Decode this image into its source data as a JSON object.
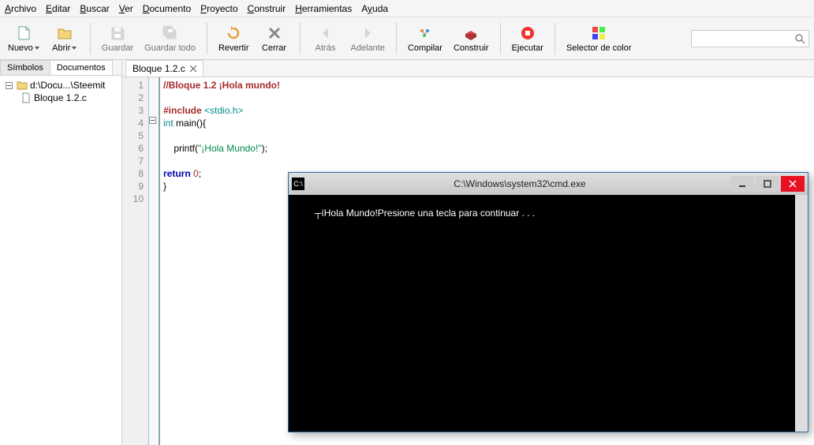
{
  "menu": [
    "Archivo",
    "Editar",
    "Buscar",
    "Ver",
    "Documento",
    "Proyecto",
    "Construir",
    "Herramientas",
    "Ayuda"
  ],
  "menu_accel": [
    0,
    0,
    0,
    0,
    0,
    0,
    0,
    0,
    1
  ],
  "toolbar": [
    {
      "id": "nuevo",
      "label": "Nuevo",
      "icon": "new",
      "dd": true
    },
    {
      "id": "abrir",
      "label": "Abrir",
      "icon": "open",
      "dd": true
    },
    {
      "sep": true
    },
    {
      "id": "guardar",
      "label": "Guardar",
      "icon": "save",
      "dis": true
    },
    {
      "id": "guardartodo",
      "label": "Guardar todo",
      "icon": "saveall",
      "dis": true
    },
    {
      "sep": true
    },
    {
      "id": "revertir",
      "label": "Revertir",
      "icon": "revert"
    },
    {
      "id": "cerrar",
      "label": "Cerrar",
      "icon": "close"
    },
    {
      "sep": true
    },
    {
      "id": "atras",
      "label": "Atrás",
      "icon": "back",
      "dis": true
    },
    {
      "id": "adelante",
      "label": "Adelante",
      "icon": "fwd",
      "dis": true
    },
    {
      "sep": true
    },
    {
      "id": "compilar",
      "label": "Compilar",
      "icon": "compile"
    },
    {
      "id": "construir",
      "label": "Construir",
      "icon": "build"
    },
    {
      "sep": true
    },
    {
      "id": "ejecutar",
      "label": "Ejecutar",
      "icon": "run"
    },
    {
      "sep": true
    },
    {
      "id": "selcolor",
      "label": "Selector de color",
      "icon": "color"
    }
  ],
  "sidebar": {
    "tabs": [
      "Símbolos",
      "Documentos"
    ],
    "active": 1,
    "folder": "d:\\Docu...\\Steemit",
    "file": "Bloque 1.2.c"
  },
  "editor_tab": "Bloque 1.2.c",
  "code_lines": [
    {
      "n": 1,
      "html": "<span class='c-brown'>//Bloque 1.2 ¡Hola mundo!</span>"
    },
    {
      "n": 2,
      "html": ""
    },
    {
      "n": 3,
      "html": "<span class='c-brown'>#include</span> <span class='c-type'>&lt;stdio.h&gt;</span>"
    },
    {
      "n": 4,
      "html": "<span class='c-type'>int</span> main(){",
      "fold": "-"
    },
    {
      "n": 5,
      "html": ""
    },
    {
      "n": 6,
      "html": "    printf(<span class='c-string'>\"¡Hola Mundo!\"</span>);"
    },
    {
      "n": 7,
      "html": ""
    },
    {
      "n": 8,
      "html": "<span class='c-keyword'>return</span> <span class='c-num'>0</span>;"
    },
    {
      "n": 9,
      "html": "}",
      "fold": "end"
    },
    {
      "n": 10,
      "html": ""
    }
  ],
  "console": {
    "title": "C:\\Windows\\system32\\cmd.exe",
    "output": "┬íHola Mundo!Presione una tecla para continuar . . ."
  }
}
